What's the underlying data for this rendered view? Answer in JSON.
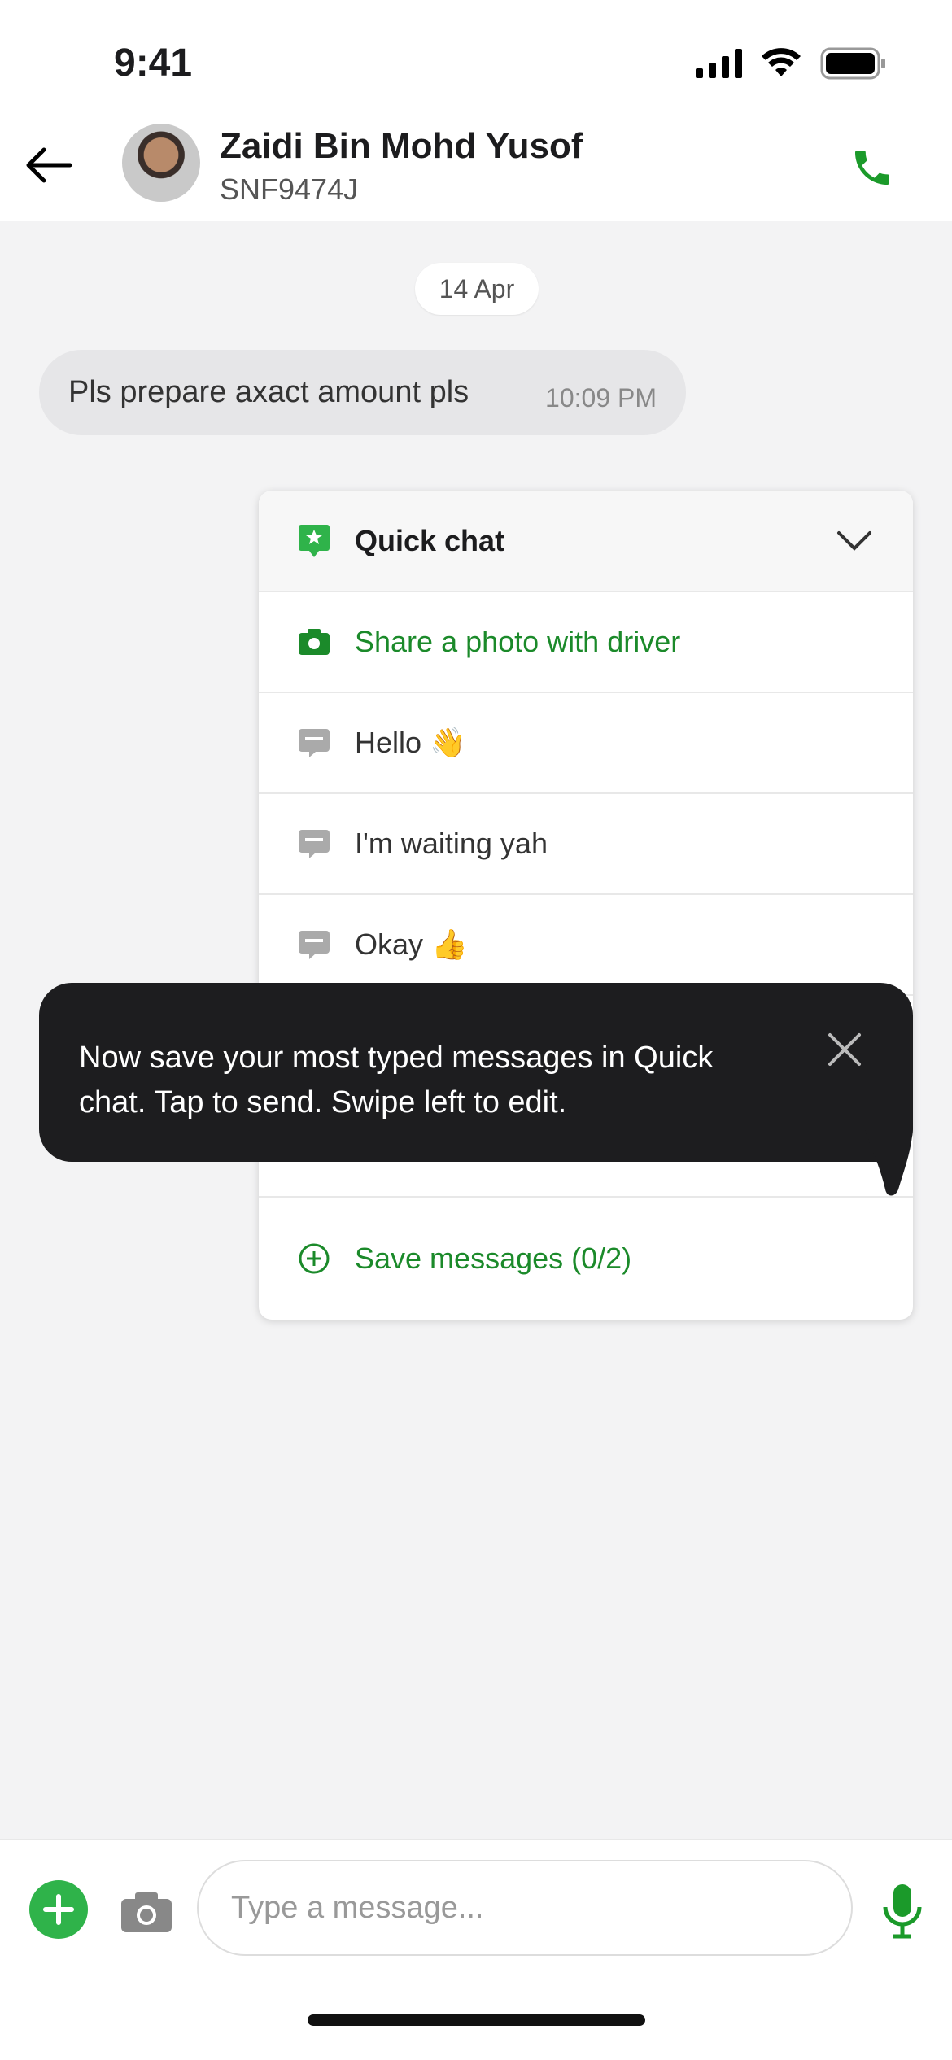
{
  "status_bar": {
    "time": "9:41"
  },
  "header": {
    "name": "Zaidi Bin Mohd Yusof",
    "plate": "SNF9474J"
  },
  "chat": {
    "date": "14 Apr",
    "messages": [
      {
        "text": "Pls prepare axact amount pls",
        "time": "10:09 PM"
      }
    ]
  },
  "quick_chat": {
    "title": "Quick chat",
    "share_photo": "Share a photo with driver",
    "items": [
      "Hello 👋",
      "I'm waiting yah",
      "Okay 👍"
    ],
    "save_label": "Save messages (0/2)"
  },
  "tooltip": {
    "text": "Now save your most typed messages in Quick chat. Tap to send. Swipe left to edit."
  },
  "composer": {
    "placeholder": "Type a message..."
  },
  "colors": {
    "accent": "#1b8a2a",
    "plus": "#2fb34a",
    "tooltip_bg": "#1d1d1f"
  }
}
